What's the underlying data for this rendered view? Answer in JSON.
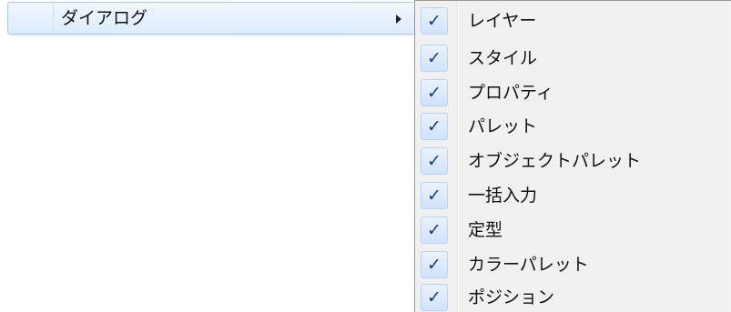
{
  "parent_menu": {
    "highlighted_item_label": "ダイアログ",
    "submenu_arrow_icon": "triangle-right-icon"
  },
  "submenu": {
    "check_glyph": "✓",
    "items": [
      {
        "label": "レイヤー",
        "checked": true
      },
      {
        "label": "スタイル",
        "checked": true
      },
      {
        "label": "プロパティ",
        "checked": true
      },
      {
        "label": "パレット",
        "checked": true
      },
      {
        "label": "オブジェクトパレット",
        "checked": true
      },
      {
        "label": "一括入力",
        "checked": true
      },
      {
        "label": "定型",
        "checked": true
      },
      {
        "label": "カラーパレット",
        "checked": true
      },
      {
        "label": "ポジション",
        "checked": true
      }
    ]
  },
  "colors": {
    "highlight_border": "#a8c8ec",
    "check_color": "#1c3a8c",
    "menu_background": "#f0f0f0"
  }
}
